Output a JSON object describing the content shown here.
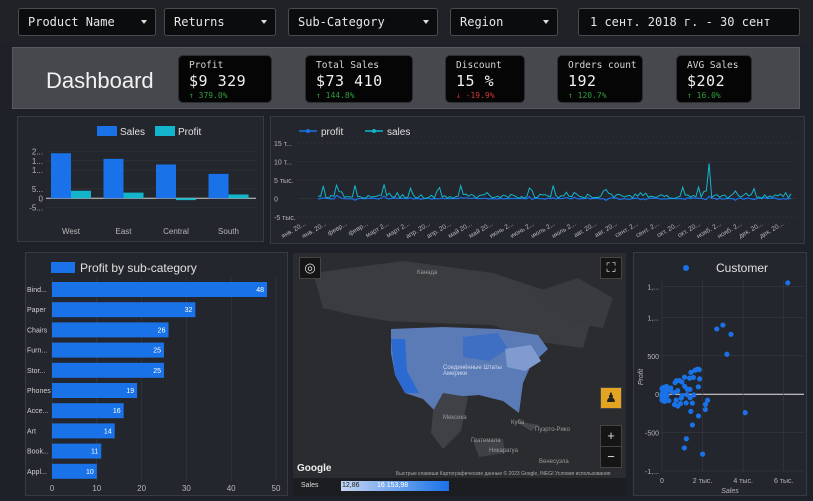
{
  "filters": {
    "product_name": "Product Name",
    "returns": "Returns",
    "sub_category": "Sub-Category",
    "region": "Region",
    "date_range": "1 сент. 2018 г. - 30 сент"
  },
  "dashboard_title": "Dashboard",
  "kpis": [
    {
      "label": "Profit",
      "value": "$9 329",
      "delta": "↑ 379.0%",
      "dir": "up"
    },
    {
      "label": "Total Sales",
      "value": "$73 410",
      "delta": "↑ 144.8%",
      "dir": "up"
    },
    {
      "label": "Discount",
      "value": "15 %",
      "delta": "↓ -19.9%",
      "dir": "down"
    },
    {
      "label": "Orders count",
      "value": "192",
      "delta": "↑ 120.7%",
      "dir": "up"
    },
    {
      "label": "AVG Sales",
      "value": "$202",
      "delta": "↑ 16.0%",
      "dir": "up"
    }
  ],
  "colors": {
    "sales": "#1a72e8",
    "profit": "#12b5cb",
    "bar": "#1a72e8"
  },
  "chart_data": [
    {
      "type": "bar",
      "categories": [
        "West",
        "East",
        "Central",
        "South"
      ],
      "series": [
        {
          "name": "Sales",
          "values": [
            24,
            21,
            18,
            13
          ]
        },
        {
          "name": "Profit",
          "values": [
            4,
            3,
            -1,
            2
          ]
        }
      ],
      "legend": "top",
      "yticks": [
        "2...",
        "1...",
        "1...",
        "5...",
        "0",
        "-5..."
      ]
    },
    {
      "type": "line",
      "series": [
        {
          "name": "profit"
        },
        {
          "name": "sales"
        }
      ],
      "yticks": [
        "15 т...",
        "10 т...",
        "5 тыс.",
        "0",
        "-5 тыс."
      ],
      "xticks": [
        "янв. 20...",
        "янв. 20...",
        "февр...",
        "февр...",
        "март 2...",
        "март 2...",
        "апр. 20...",
        "апр. 20...",
        "май 20...",
        "май 20...",
        "июнь 2...",
        "июнь 2...",
        "июль 2...",
        "июль 2...",
        "авг. 20...",
        "авг. 20...",
        "сент. 2...",
        "сент. 2...",
        "окт. 20...",
        "окт. 20...",
        "нояб. 2...",
        "нояб. 2...",
        "дек. 20...",
        "дек. 20..."
      ]
    },
    {
      "type": "bar",
      "title": "Profit by sub-category",
      "categories": [
        "Bind...",
        "Paper",
        "Chairs",
        "Furn...",
        "Stor...",
        "Phones",
        "Acce...",
        "Art",
        "Book...",
        "Appl..."
      ],
      "values": [
        48,
        32,
        26,
        25,
        25,
        19,
        16,
        14,
        11,
        10
      ],
      "xticks": [
        "0",
        "10",
        "20",
        "30",
        "40",
        "50"
      ],
      "xlim": [
        0,
        50
      ]
    },
    {
      "type": "scatter",
      "title": "Customer",
      "xlabel": "Sales",
      "ylabel": "Profit",
      "xticks": [
        "0",
        "2 тыс.",
        "4 тыс.",
        "6 тыс."
      ],
      "yticks": [
        "1,...",
        "1,...",
        "500",
        "0",
        "-500",
        "-1,..."
      ]
    }
  ],
  "map": {
    "labels": [
      "Канада",
      "Мексика",
      "Куба",
      "Гватемала",
      "Никарагуа",
      "Пуэрто-Рико",
      "Венесуэла",
      "Соединённые Штаты Америки"
    ],
    "google": "Google",
    "attribution": "Быстрые клавиши  Картографические данные © 2023 Google, INEGI  Условия использования",
    "scale_label": "Sales",
    "scale_min": "12,86",
    "scale_max": "16 153,98"
  }
}
